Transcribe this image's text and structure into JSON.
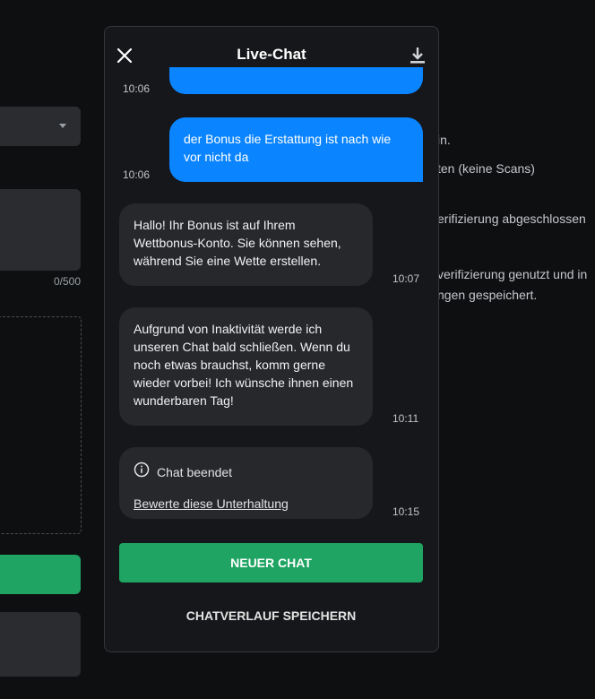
{
  "background": {
    "counter": "0/500",
    "texts": [
      "in.",
      "ten (keine Scans)",
      "erifizierung abgeschlossen",
      "verifizierung genutzt und in",
      "ngen gespeichert."
    ]
  },
  "chat": {
    "title": "Live-Chat",
    "close_icon": "close-icon",
    "download_icon": "download-icon",
    "messages": [
      {
        "from": "user",
        "text": "",
        "time": "10:06"
      },
      {
        "from": "user",
        "text": "der Bonus die Erstattung ist nach wie vor nicht da",
        "time": "10:06"
      },
      {
        "from": "agent",
        "text": "Hallo! Ihr Bonus ist auf Ihrem Wettbonus-Konto. Sie können sehen, während Sie eine Wette erstellen.",
        "time": "10:07"
      },
      {
        "from": "agent",
        "text": "Aufgrund von Inaktivität werde ich unseren Chat bald schließen. Wenn du noch etwas brauchst, komm gerne wieder vorbei! Ich wünsche ihnen einen wunderbaren Tag!",
        "time": "10:11"
      }
    ],
    "ended": {
      "label": "Chat beendet",
      "rate_link": "Bewerte diese Unterhaltung",
      "time": "10:15",
      "icon": "info-icon"
    },
    "new_chat_label": "NEUER CHAT",
    "save_history_label": "CHATVERLAUF SPEICHERN"
  },
  "colors": {
    "accent_blue": "#0a84ff",
    "accent_green": "#1fa463"
  }
}
